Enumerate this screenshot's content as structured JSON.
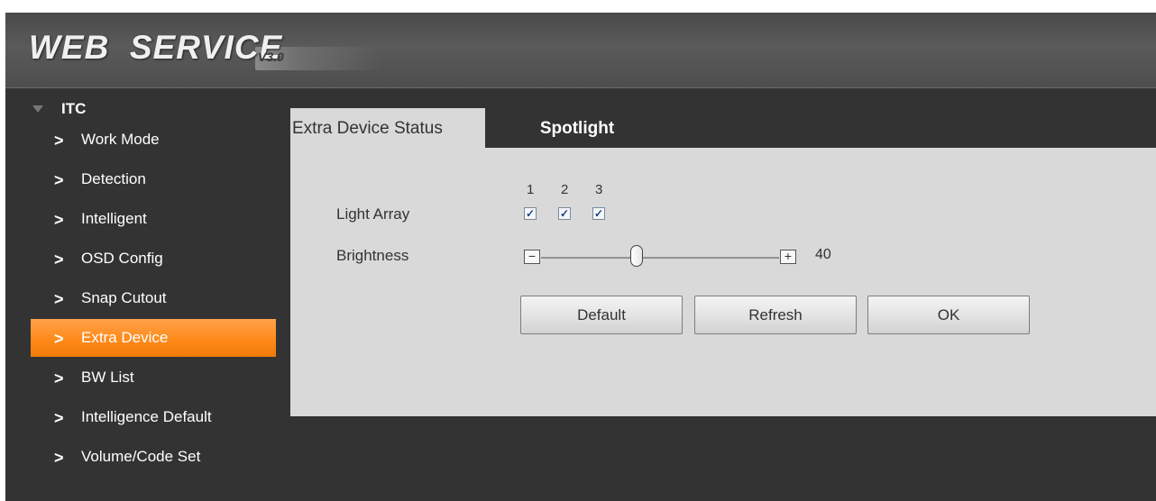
{
  "header": {
    "title": "WEB  SERVICE",
    "version": "V3.0"
  },
  "sidebar": {
    "root": {
      "label": "ITC",
      "icon": "triangle-down-icon"
    },
    "items": [
      {
        "label": "Work Mode"
      },
      {
        "label": "Detection"
      },
      {
        "label": "Intelligent"
      },
      {
        "label": "OSD Config"
      },
      {
        "label": "Snap Cutout"
      },
      {
        "label": "Extra Device",
        "active": true
      },
      {
        "label": "BW List"
      },
      {
        "label": "Intelligence Default"
      },
      {
        "label": "Volume/Code Set"
      }
    ],
    "chevron": ">"
  },
  "tabs": [
    {
      "label": "Extra Device Status",
      "active": false
    },
    {
      "label": "Spotlight",
      "active": true
    }
  ],
  "form": {
    "light_array": {
      "label": "Light Array",
      "columns": [
        "1",
        "2",
        "3"
      ],
      "checked": [
        true,
        true,
        true
      ],
      "check_mark": "✓"
    },
    "brightness": {
      "label": "Brightness",
      "value": "40",
      "level": 0.4,
      "minus": "−",
      "plus": "+"
    }
  },
  "buttons": {
    "default_label": "Default",
    "refresh_label": "Refresh",
    "ok_label": "OK"
  },
  "colors": {
    "accent": "#ff8c1a",
    "background": "#333333",
    "panel": "#d9d9d9"
  }
}
